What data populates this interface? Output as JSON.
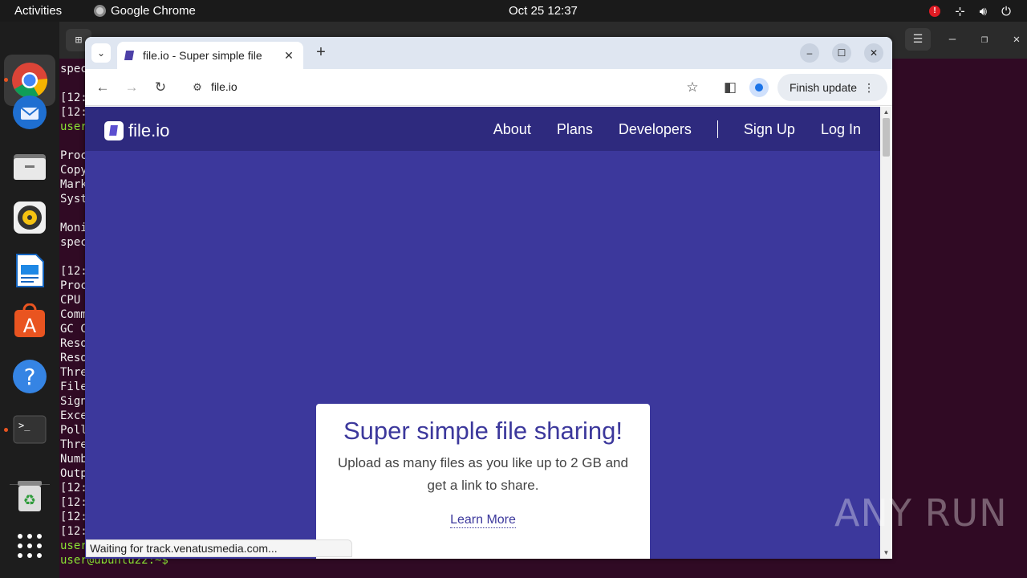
{
  "topbar": {
    "activities": "Activities",
    "app_name": "Google Chrome",
    "clock": "Oct 25  12:37"
  },
  "terminal": {
    "lines": [
      {
        "text": "spec"
      },
      {
        "text": ""
      },
      {
        "text": "[12:"
      },
      {
        "text": "[12:"
      },
      {
        "text": "user"
      },
      {
        "text": ""
      },
      {
        "text": "Proc"
      },
      {
        "text": "Copy"
      },
      {
        "text": "Mark"
      },
      {
        "text": "Syst"
      },
      {
        "text": ""
      },
      {
        "text": "Moni"
      },
      {
        "text": "spec"
      },
      {
        "text": ""
      },
      {
        "text": "[12:"
      },
      {
        "text": "Proc"
      },
      {
        "text": "CPU"
      },
      {
        "text": "Comm"
      },
      {
        "text": "GC C"
      },
      {
        "text": "Reso"
      },
      {
        "text": "Reso"
      },
      {
        "text": "Thre"
      },
      {
        "text": "File"
      },
      {
        "text": "Sign"
      },
      {
        "text": "Exce"
      },
      {
        "text": "Poll"
      },
      {
        "text": "Thre"
      },
      {
        "text": "Numb"
      },
      {
        "text": "Outp"
      },
      {
        "text": "[12:"
      },
      {
        "text": "[12:"
      },
      {
        "text": "[12:"
      },
      {
        "text": "[12:"
      },
      {
        "text": "user"
      },
      {
        "text": "user@ubuntu22:~$ "
      }
    ]
  },
  "chrome": {
    "tab_title": "file.io - Super simple file",
    "url": "file.io",
    "finish_update": "Finish update",
    "status": "Waiting for track.venatusmedia.com..."
  },
  "site": {
    "logo": "file.io",
    "nav": [
      "About",
      "Plans",
      "Developers",
      "Sign Up",
      "Log In"
    ],
    "hero_title": "Super simple file sharing!",
    "hero_text": "Upload as many files as you like up to 2 GB and get a link to share.",
    "hero_link": "Learn More"
  },
  "watermark": "ANY RUN"
}
